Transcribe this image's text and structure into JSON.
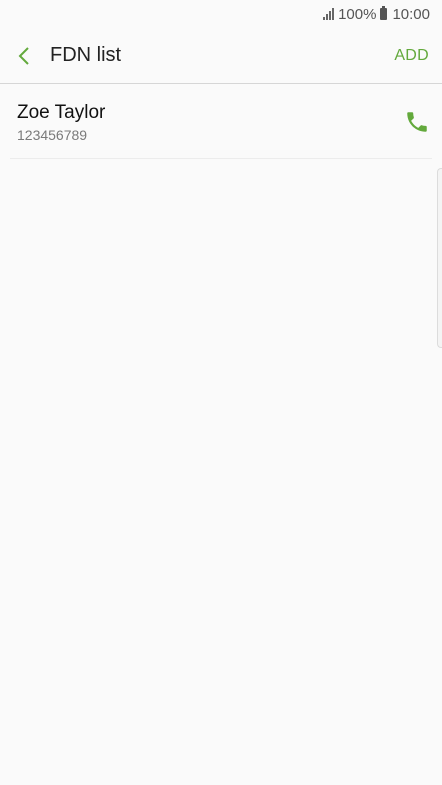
{
  "status_bar": {
    "signal_icon": "signal-icon",
    "battery_text": "100%",
    "battery_icon": "battery-icon",
    "time": "10:00"
  },
  "app_bar": {
    "back_icon": "chevron-left-icon",
    "title": "FDN list",
    "add_label": "ADD"
  },
  "contacts": [
    {
      "name": "Zoe Taylor",
      "number": "123456789",
      "action_icon": "phone-icon"
    }
  ],
  "colors": {
    "accent": "#63a93c",
    "background": "#fafafa"
  }
}
